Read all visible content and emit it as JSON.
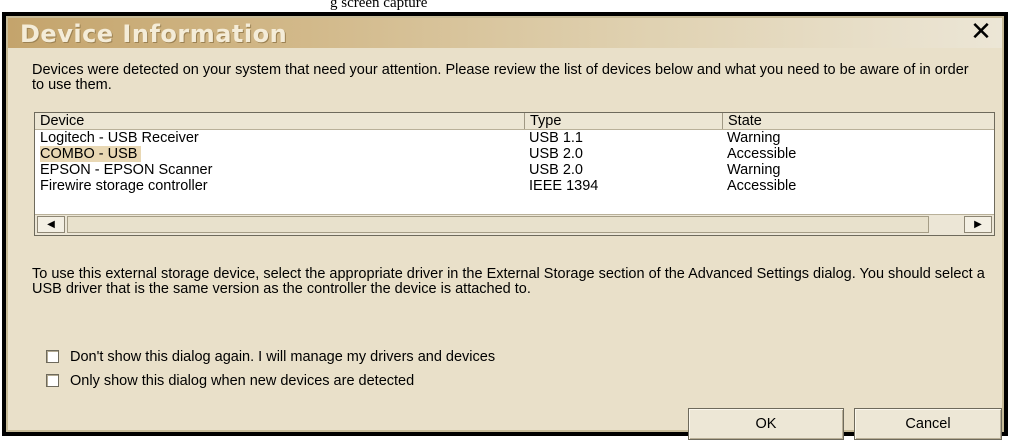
{
  "page_caption": "g screen capture",
  "dialog": {
    "title": "Device Information",
    "close_glyph": "✕",
    "intro_text": "Devices were detected on your system that need your attention. Please review the list of devices below and what you need to be aware of in order to use them.",
    "columns": {
      "device": "Device",
      "type": "Type",
      "state": "State"
    },
    "rows": [
      {
        "device": "Logitech - USB Receiver",
        "type": "USB 1.1",
        "state": "Warning"
      },
      {
        "device": "COMBO - USB",
        "type": "USB 2.0",
        "state": "Accessible",
        "selected": true
      },
      {
        "device": "EPSON - EPSON Scanner",
        "type": "USB 2.0",
        "state": "Warning"
      },
      {
        "device": "Firewire storage controller",
        "type": "IEEE 1394",
        "state": "Accessible"
      }
    ],
    "scroll_left_glyph": "◀",
    "scroll_right_glyph": "▶",
    "description": "To use this external storage device, select the appropriate driver in the External Storage section of the Advanced Settings dialog. You should select a USB driver that is the same version as the controller the device is attached to.",
    "checkboxes": [
      {
        "label": "Don't show this dialog again. I will manage my drivers and devices",
        "checked": false
      },
      {
        "label": "Only show this dialog when new devices are detected",
        "checked": false
      }
    ],
    "ok_label": "OK",
    "cancel_label": "Cancel"
  }
}
